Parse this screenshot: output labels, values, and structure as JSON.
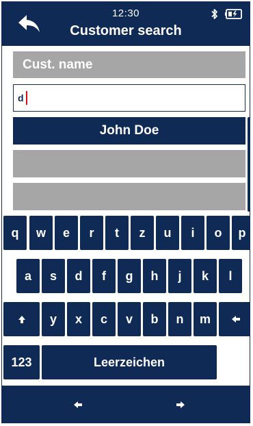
{
  "header": {
    "time": "12:30",
    "title": "Customer search",
    "back_icon": "back-arrow-icon",
    "bluetooth_icon": "bluetooth-icon",
    "battery_icon": "battery-charging-icon"
  },
  "search": {
    "label": "Cust. name",
    "value": "d"
  },
  "results": [
    "John Doe",
    "",
    ""
  ],
  "keyboard": {
    "row1": [
      "q",
      "w",
      "e",
      "r",
      "t",
      "z",
      "u",
      "i",
      "o",
      "p"
    ],
    "row2": [
      "a",
      "s",
      "d",
      "f",
      "g",
      "h",
      "j",
      "k",
      "l"
    ],
    "row3": [
      "y",
      "x",
      "c",
      "v",
      "b",
      "n",
      "m"
    ],
    "shift_icon": "shift-arrow-icon",
    "backspace_icon": "backspace-arrow-icon",
    "numbers_label": "123",
    "space_label": "Leerzeichen"
  },
  "footer": {
    "prev_icon": "left-arrow-icon",
    "next_icon": "right-arrow-icon"
  },
  "colors": {
    "primary": "#0f2a55",
    "grey": "#a6a6a6",
    "caret": "#d41010"
  }
}
